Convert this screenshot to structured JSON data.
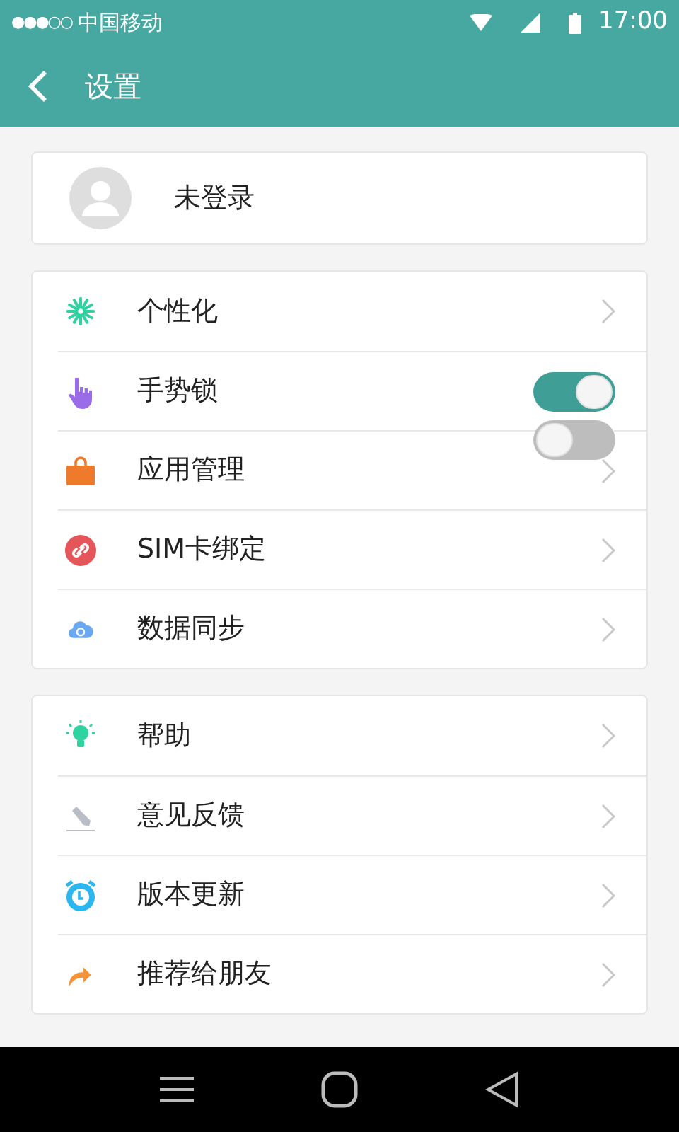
{
  "status_bar": {
    "signal_dots": "●●●○○",
    "carrier": "中国移动",
    "time": "17:00"
  },
  "header": {
    "title": "设置"
  },
  "profile": {
    "name": "未登录"
  },
  "groups": [
    {
      "rows": [
        {
          "label": "个性化",
          "chevron": true
        },
        {
          "label": "手势锁",
          "chevron": false,
          "switch": {
            "on": true
          }
        },
        {
          "label": "应用管理",
          "chevron": true,
          "switch": {
            "on": false
          }
        },
        {
          "label": "SIM卡绑定",
          "chevron": true
        },
        {
          "label": "数据同步",
          "chevron": true
        }
      ]
    },
    {
      "rows": [
        {
          "label": "帮助",
          "chevron": true
        },
        {
          "label": "意见反馈",
          "chevron": true
        },
        {
          "label": "版本更新",
          "chevron": true
        },
        {
          "label": "推荐给朋友",
          "chevron": true
        }
      ]
    }
  ]
}
